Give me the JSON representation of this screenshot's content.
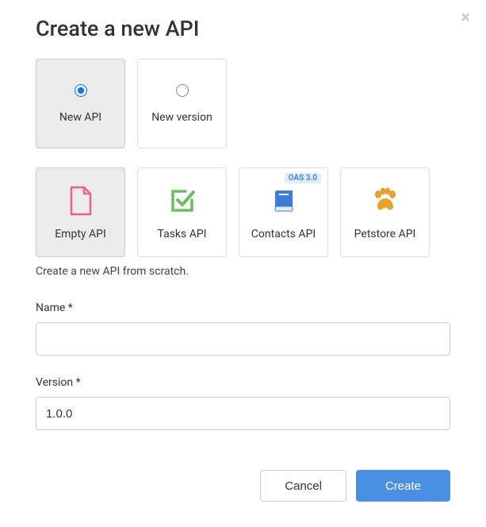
{
  "dialog": {
    "title": "Create a new API",
    "close_label": "×"
  },
  "types": [
    {
      "label": "New API",
      "selected": true
    },
    {
      "label": "New version",
      "selected": false
    }
  ],
  "templates": [
    {
      "label": "Empty API",
      "selected": true,
      "badge": null,
      "icon": "file"
    },
    {
      "label": "Tasks API",
      "selected": false,
      "badge": null,
      "icon": "check"
    },
    {
      "label": "Contacts API",
      "selected": false,
      "badge": "OAS 3.0",
      "icon": "book"
    },
    {
      "label": "Petstore API",
      "selected": false,
      "badge": null,
      "icon": "paw"
    }
  ],
  "description": "Create a new API from scratch.",
  "fields": {
    "name": {
      "label": "Name *",
      "value": ""
    },
    "version": {
      "label": "Version *",
      "value": "1.0.0"
    }
  },
  "buttons": {
    "cancel": "Cancel",
    "create": "Create"
  }
}
